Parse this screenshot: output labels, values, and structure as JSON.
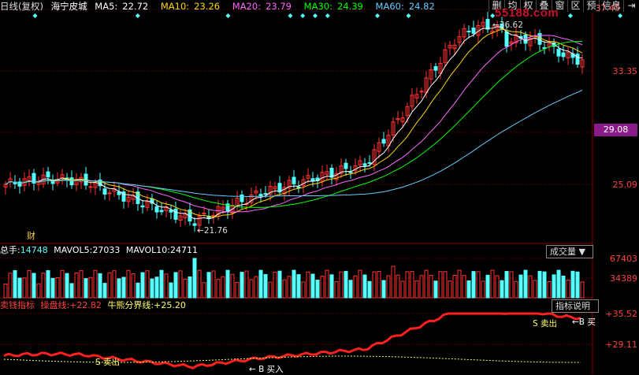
{
  "header": {
    "period": "日线(复权)",
    "stock_name": "海宁皮城",
    "ma5": {
      "label": "MA5:",
      "value": "22.72",
      "color": "#ffffff"
    },
    "ma10": {
      "label": "MA10:",
      "value": "23.26",
      "color": "#ffd700"
    },
    "ma20": {
      "label": "MA20:",
      "value": "23.79",
      "color": "#ff66ff"
    },
    "ma30": {
      "label": "MA30:",
      "value": "24.39",
      "color": "#00ff00"
    },
    "ma60": {
      "label": "MA60:",
      "value": "24.82",
      "color": "#66ccff"
    }
  },
  "toolbar": {
    "items": [
      "删",
      "均",
      "权",
      "叠",
      "窗",
      "区",
      "预",
      "信息",
      "⇥"
    ]
  },
  "watermark": "55188.com",
  "price_axis": {
    "labels": [
      "37.45",
      "33.35",
      "29.08",
      "25.09"
    ],
    "current_price": "29.08"
  },
  "annotations": {
    "high": "36.62",
    "low": "21.76",
    "cai": "财"
  },
  "volume_panel": {
    "total_label": "总手:",
    "total_value": "14748",
    "mavol5_label": "MAVOL5:",
    "mavol5_value": "27033",
    "mavol10_label": "MAVOL10:",
    "mavol10_value": "24711",
    "selector": "成交量 ▼",
    "axis": [
      "67403",
      "34389"
    ]
  },
  "indicator_panel": {
    "name": "卖钱指标",
    "line1_label": "操盘线:",
    "line1_value": "+22.82",
    "line2_label": "牛熊分界线:",
    "line2_value": "+25.20",
    "help_button": "指标说明",
    "axis": [
      "+35.52",
      "+29.11"
    ],
    "signals": {
      "sell": "卖出",
      "buy_right": "←B 买",
      "buy_left": "B 买入",
      "sell_left": "S 卖出"
    }
  },
  "colors": {
    "up": "#ff3333",
    "down": "#54ffff",
    "grid": "#8b0000",
    "diamond": "#54ffff"
  }
}
